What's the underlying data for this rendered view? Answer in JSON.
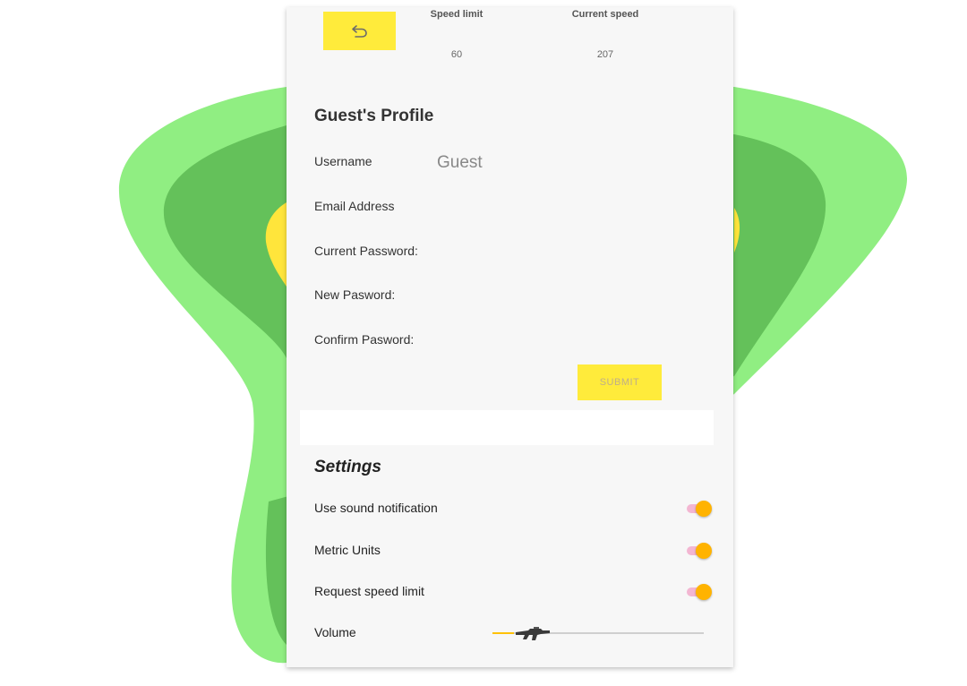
{
  "header": {
    "back_icon": "undo-arrow-icon",
    "speed_limit_label": "Speed limit",
    "speed_limit_value": "60",
    "current_speed_label": "Current speed",
    "current_speed_value": "207"
  },
  "profile": {
    "title": "Guest's Profile",
    "fields": [
      {
        "label": "Username",
        "value": "Guest"
      },
      {
        "label": "Email Address",
        "value": ""
      },
      {
        "label": "Current Password:",
        "value": ""
      },
      {
        "label": "New Pasword:",
        "value": ""
      },
      {
        "label": "Confirm Pasword:",
        "value": ""
      }
    ],
    "submit_label": "SUBMIT"
  },
  "settings": {
    "title": "Settings",
    "toggles": [
      {
        "label": "Use sound notification",
        "on": true
      },
      {
        "label": "Metric Units",
        "on": true
      },
      {
        "label": "Request speed limit",
        "on": true
      }
    ],
    "volume_label": "Volume",
    "volume_level": 0.1,
    "volume_thumb_icon": "rifle-icon"
  },
  "colors": {
    "accent_yellow": "#ffeb3b",
    "toggle_thumb": "#ffb300",
    "toggle_track": "#f3b6d2",
    "bg_green_light": "#90ee82",
    "bg_green_dark": "#64c15a",
    "bg_yellow": "#ffe53b"
  }
}
